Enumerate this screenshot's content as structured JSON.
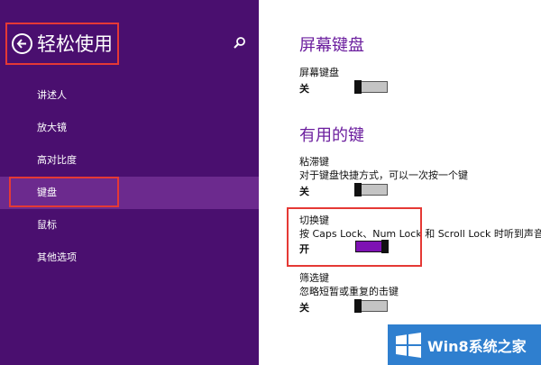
{
  "sidebar": {
    "title": "轻松使用",
    "items": [
      {
        "label": "讲述人"
      },
      {
        "label": "放大镜"
      },
      {
        "label": "高对比度"
      },
      {
        "label": "键盘",
        "selected": true
      },
      {
        "label": "鼠标"
      },
      {
        "label": "其他选项"
      }
    ]
  },
  "content": {
    "on_screen_keyboard": {
      "heading": "屏幕键盘",
      "label": "屏幕键盘",
      "state": "关"
    },
    "useful_keys": {
      "heading": "有用的键",
      "sticky_keys": {
        "label": "粘滞键",
        "description": "对于键盘快捷方式，可以一次按一个键",
        "state": "关"
      },
      "toggle_keys": {
        "label": "切换键",
        "description": "按 Caps Lock、Num Lock 和 Scroll Lock 时听到声音",
        "state": "开"
      },
      "filter_keys": {
        "label": "筛选键",
        "description": "忽略短暂或重复的击键",
        "state": "关"
      }
    }
  },
  "watermark": {
    "text": "Win8系统之家"
  },
  "colors": {
    "sidebar_bg": "#4a0f6f",
    "selected_bg": "#6c2a8e",
    "accent": "#7e12b3",
    "highlight": "#e53935"
  }
}
